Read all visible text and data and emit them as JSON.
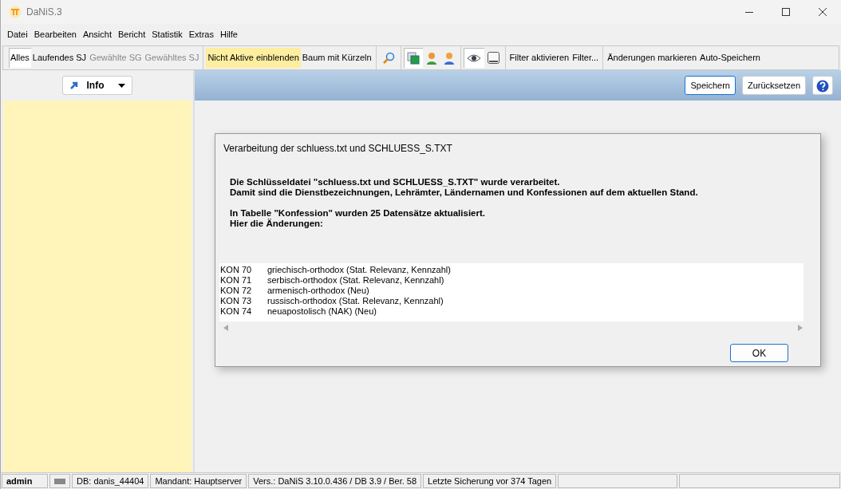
{
  "window": {
    "title": "DaNiS.3"
  },
  "menu": [
    "Datei",
    "Bearbeiten",
    "Ansicht",
    "Bericht",
    "Statistik",
    "Extras",
    "Hilfe"
  ],
  "toolbar": [
    [
      {
        "kind": "text",
        "label": "Alles",
        "pressed": true,
        "disabled": false
      },
      {
        "kind": "text",
        "label": "Laufendes SJ",
        "pressed": false,
        "disabled": false
      },
      {
        "kind": "text",
        "label": "Gewählte SG",
        "pressed": false,
        "disabled": true
      },
      {
        "kind": "text",
        "label": "Gewähltes SJ",
        "pressed": false,
        "disabled": true
      }
    ],
    [
      {
        "kind": "text",
        "label": "Nicht Aktive einblenden",
        "pressed": true,
        "disabled": false
      },
      {
        "kind": "text",
        "label": "Baum mit Kürzeln",
        "pressed": false,
        "disabled": false
      }
    ],
    [
      {
        "kind": "icon",
        "pressed": false
      }
    ],
    [
      {
        "kind": "icon",
        "pressed": true
      },
      {
        "kind": "icon",
        "pressed": false
      },
      {
        "kind": "icon",
        "pressed": false
      }
    ],
    [
      {
        "kind": "icon",
        "pressed": true
      },
      {
        "kind": "icon",
        "pressed": false
      }
    ],
    [
      {
        "kind": "text",
        "label": "Filter aktivieren",
        "pressed": false,
        "disabled": false
      },
      {
        "kind": "text",
        "label": "Filter...",
        "pressed": false,
        "disabled": false
      }
    ],
    [
      {
        "kind": "text",
        "label": "Änderungen markieren",
        "pressed": false,
        "disabled": false
      },
      {
        "kind": "text",
        "label": "Auto-Speichern",
        "pressed": false,
        "disabled": false
      }
    ]
  ],
  "left_panel": {
    "button": "Info"
  },
  "header_buttons": [
    "Speichern",
    "Zurücksetzen"
  ],
  "dialog": {
    "title": "Verarbeitung der schluess.txt und SCHLUESS_S.TXT",
    "message": [
      [
        "Die Schlüsseldatei \"schluess.txt und SCHLUESS_S.TXT\" wurde verarbeitet.",
        "Damit sind die Dienstbezeichnungen, Lehrämter, Ländernamen und Konfessionen auf dem aktuellen Stand."
      ],
      [
        "In Tabelle \"Konfession\" wurden 25 Datensätze aktualisiert.",
        "Hier die Änderungen:"
      ]
    ],
    "changes": [
      {
        "code": "KON 70",
        "text": "griechisch-orthodox (Stat. Relevanz, Kennzahl)"
      },
      {
        "code": "KON 71",
        "text": "serbisch-orthodox (Stat. Relevanz, Kennzahl)"
      },
      {
        "code": "KON 72",
        "text": "armenisch-orthodox (Neu)"
      },
      {
        "code": "KON 73",
        "text": "russisch-orthodox (Stat. Relevanz, Kennzahl)"
      },
      {
        "code": "KON 74",
        "text": "neuapostolisch (NAK) (Neu)"
      }
    ],
    "button": "OK"
  },
  "status_bar": [
    {
      "kind": "user",
      "text": "admin"
    },
    {
      "kind": "icon"
    },
    {
      "kind": "text",
      "text": "DB: danis_44404"
    },
    {
      "kind": "text",
      "text": "Mandant: Hauptserver"
    },
    {
      "kind": "text",
      "text": "Vers.: DaNiS 3.10.0.436 / DB 3.9 / Ber. 58"
    },
    {
      "kind": "text",
      "text": "Letzte Sicherung vor 374 Tagen"
    },
    {
      "kind": "empty"
    },
    {
      "kind": "empty"
    }
  ]
}
